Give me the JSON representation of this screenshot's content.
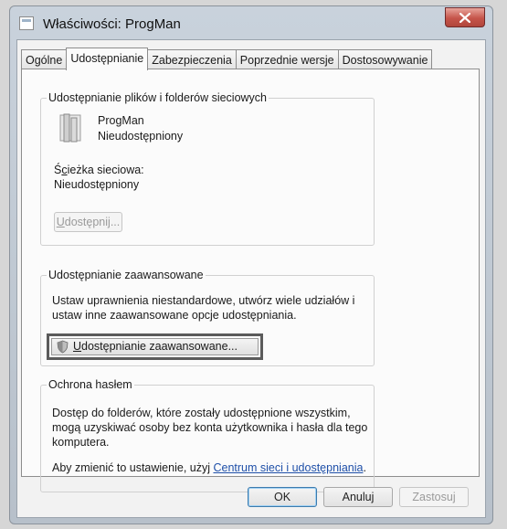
{
  "window": {
    "title": "Właściwości: ProgMan"
  },
  "tabs": [
    {
      "label": "Ogólne"
    },
    {
      "label": "Udostępnianie"
    },
    {
      "label": "Zabezpieczenia"
    },
    {
      "label": "Poprzednie wersje"
    },
    {
      "label": "Dostosowywanie"
    }
  ],
  "sharing": {
    "group_title": "Udostępnianie plików i folderów sieciowych",
    "folder_name": "ProgMan",
    "folder_status": "Nieudostępniony",
    "path_label": "Ścieżka sieciowa:",
    "path_value": "Nieudostępniony",
    "share_button": "Udostępnij..."
  },
  "advanced": {
    "group_title": "Udostępnianie zaawansowane",
    "desc_line1": "Ustaw uprawnienia niestandardowe, utwórz wiele udziałów i",
    "desc_line2": "ustaw inne zaawansowane opcje udostępniania.",
    "button": "Udostępnianie zaawansowane..."
  },
  "password": {
    "group_title": "Ochrona hasłem",
    "line1": "Dostęp do folderów, które zostały udostępnione wszystkim,",
    "line2": "mogą uzyskiwać osoby bez konta użytkownika i hasła dla tego",
    "line3": "komputera.",
    "change_prefix": "Aby zmienić to ustawienie, użyj ",
    "change_link": "Centrum sieci i udostępniania",
    "change_suffix": "."
  },
  "footer": {
    "ok": "OK",
    "cancel": "Anuluj",
    "apply": "Zastosuj"
  }
}
